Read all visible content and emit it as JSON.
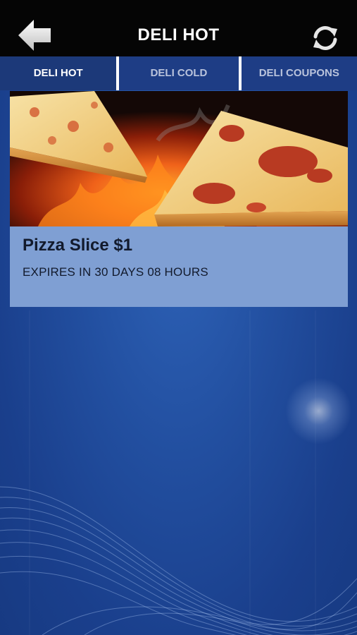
{
  "header": {
    "title": "DELI HOT",
    "back_icon": "back-arrow-icon",
    "refresh_icon": "refresh-icon"
  },
  "tabs": [
    {
      "label": "DELI HOT",
      "active": true
    },
    {
      "label": "DELI COLD",
      "active": false
    },
    {
      "label": "DELI COUPONS",
      "active": false
    }
  ],
  "offers": [
    {
      "title": "Pizza Slice $1",
      "expiry": "EXPIRES IN 30 DAYS 08 HOURS",
      "image": "pizza-slices-on-fire"
    }
  ],
  "colors": {
    "header_bg": "#050505",
    "tab_bar_bg": "#1e3d85",
    "card_bg": "#7f9fd3",
    "background": "#224fa0"
  }
}
